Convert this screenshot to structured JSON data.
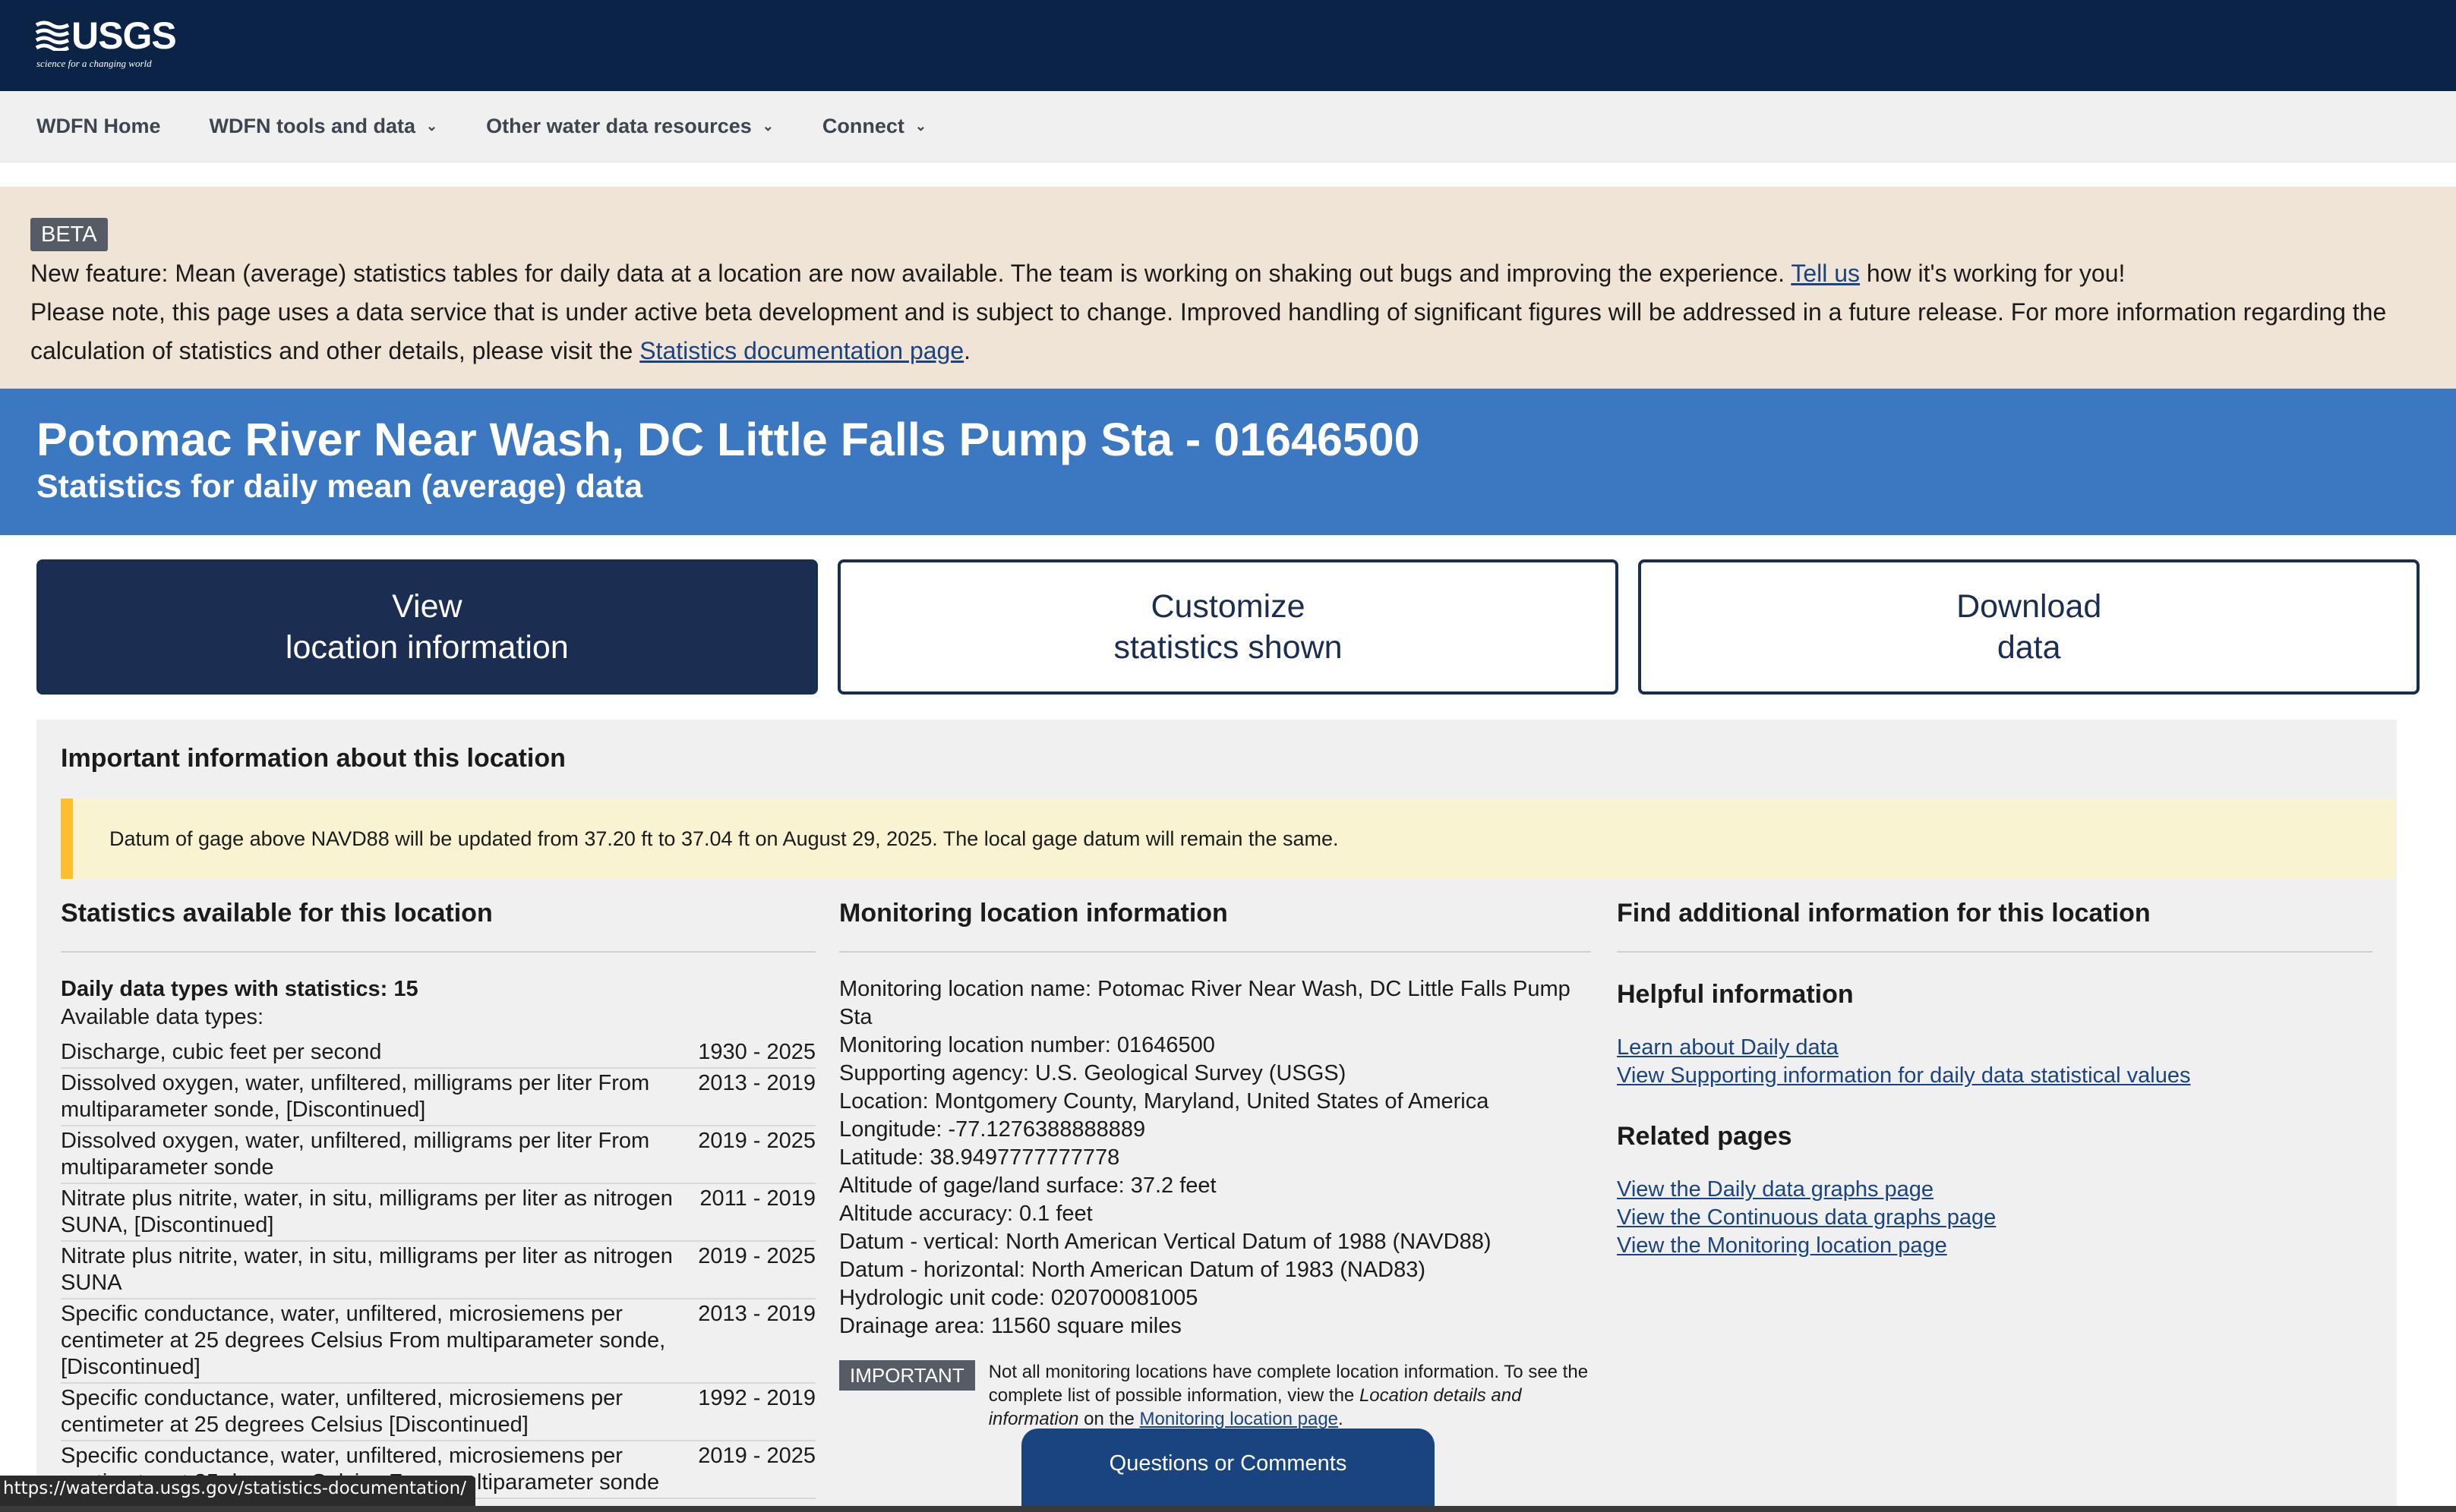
{
  "header": {
    "logo_text": "USGS",
    "logo_tagline": "science for a changing world"
  },
  "nav": {
    "items": [
      {
        "label": "WDFN Home",
        "dropdown": false
      },
      {
        "label": "WDFN tools and data",
        "dropdown": true
      },
      {
        "label": "Other water data resources",
        "dropdown": true
      },
      {
        "label": "Connect",
        "dropdown": true
      }
    ]
  },
  "beta_banner": {
    "tag": "BETA",
    "line1_text": "New feature: Mean (average) statistics tables for daily data at a location are now available. The team is working on shaking out bugs and improving the experience. ",
    "line1_link": "Tell us",
    "line1_tail": " how it's working for you!",
    "line2_text": "Please note, this page uses a data service that is under active beta development and is subject to change. Improved handling of significant figures will be addressed in a future release. For more information regarding the calculation of statistics and other details, please visit the ",
    "line2_link": "Statistics documentation page",
    "line2_tail": "."
  },
  "title": {
    "main": "Potomac River Near Wash, DC Little Falls Pump Sta - 01646500",
    "sub": "Statistics for daily mean (average) data"
  },
  "buttons": {
    "view": {
      "line1": "View",
      "line2": "location information"
    },
    "customize": {
      "line1": "Customize",
      "line2": "statistics shown"
    },
    "download": {
      "line1": "Download",
      "line2": "data"
    }
  },
  "important_info": {
    "heading": "Important information about this location",
    "alert": "Datum of gage above NAVD88 will be updated from 37.20 ft to 37.04 ft on August 29, 2025. The local gage datum will remain the same."
  },
  "statistics": {
    "heading": "Statistics available for this location",
    "count_label": "Daily data types with statistics: 15",
    "available_label": "Available data types:",
    "rows": [
      {
        "name": "Discharge, cubic feet per second",
        "years": "1930 - 2025"
      },
      {
        "name": "Dissolved oxygen, water, unfiltered, milligrams per liter From multiparameter sonde, [Discontinued]",
        "years": "2013 - 2019"
      },
      {
        "name": "Dissolved oxygen, water, unfiltered, milligrams per liter From multiparameter sonde",
        "years": "2019 - 2025"
      },
      {
        "name": "Nitrate plus nitrite, water, in situ, milligrams per liter as nitrogen SUNA, [Discontinued]",
        "years": "2011 - 2019"
      },
      {
        "name": "Nitrate plus nitrite, water, in situ, milligrams per liter as nitrogen SUNA",
        "years": "2019 - 2025"
      },
      {
        "name": "Specific conductance, water, unfiltered, microsiemens per centimeter at 25 degrees Celsius From multiparameter sonde, [Discontinued]",
        "years": "2013 - 2019"
      },
      {
        "name": "Specific conductance, water, unfiltered, microsiemens per centimeter at 25 degrees Celsius [Discontinued]",
        "years": "1992 - 2019"
      },
      {
        "name": "Specific conductance, water, unfiltered, microsiemens per centimeter at 25 degrees Celsius From multiparameter sonde",
        "years": "2019 - 2025"
      }
    ]
  },
  "monitoring": {
    "heading": "Monitoring location information",
    "lines": [
      "Monitoring location name: Potomac River Near Wash, DC Little Falls Pump Sta",
      "Monitoring location number: 01646500",
      "Supporting agency: U.S. Geological Survey (USGS)",
      "Location: Montgomery County, Maryland, United States of America",
      "Longitude: -77.1276388888889",
      "Latitude: 38.9497777777778",
      "Altitude of gage/land surface: 37.2 feet",
      "Altitude accuracy: 0.1 feet",
      "Datum - vertical: North American Vertical Datum of 1988 (NAVD88)",
      "Datum - horizontal: North American Datum of 1983 (NAD83)",
      "Hydrologic unit code: 020700081005",
      "Drainage area: 11560 square miles"
    ],
    "important_tag": "IMPORTANT",
    "important_text1": "Not all monitoring locations have complete location information. To see the complete list of possible information, view the ",
    "important_italic": "Location details and information",
    "important_text2": " on the ",
    "important_link": "Monitoring location page",
    "important_tail": "."
  },
  "additional": {
    "heading": "Find additional information for this location",
    "helpful_heading": "Helpful information",
    "helpful_links": [
      "Learn about Daily data",
      "View Supporting information for daily data statistical values"
    ],
    "related_heading": "Related pages",
    "related_links": [
      "View the Daily data graphs page",
      "View the Continuous data graphs page",
      "View the Monitoring location page"
    ]
  },
  "feedback_button": "Questions or Comments",
  "status_url": "https://waterdata.usgs.gov/statistics-documentation/"
}
